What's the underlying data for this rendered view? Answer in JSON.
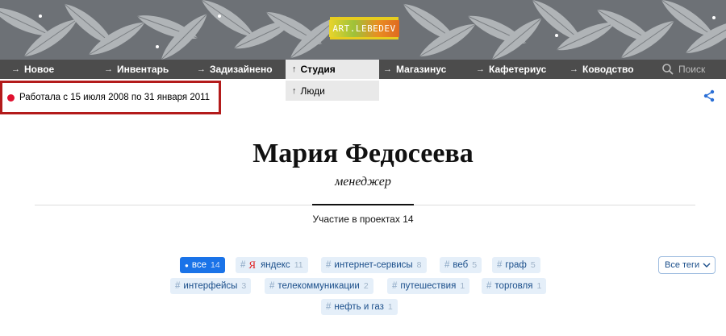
{
  "brand": {
    "logo_text": "ART.LEBEDEV"
  },
  "nav": {
    "items": [
      {
        "label": "Новое"
      },
      {
        "label": "Инвентарь"
      },
      {
        "label": "Задизайнено"
      },
      {
        "label": "Студия"
      },
      {
        "label": "Магазинус"
      },
      {
        "label": "Кафетериус"
      },
      {
        "label": "Ководство"
      }
    ],
    "sub_item": "Люди",
    "search_label": "Поиск",
    "arrow_glyph": "→",
    "up_arrow_glyph": "↑"
  },
  "status": {
    "text": "Работала с 15 июля 2008 по 31 января 2011",
    "color": "#e0102f"
  },
  "person": {
    "name": "Мария Федосеева",
    "role": "менеджер",
    "projects_text": "Участие в проектах 14"
  },
  "tags": [
    {
      "label": "все",
      "count": "14",
      "active": true
    },
    {
      "label": "яндекс",
      "count": "11",
      "icon": "Я"
    },
    {
      "label": "интернет-сервисы",
      "count": "8"
    },
    {
      "label": "веб",
      "count": "5"
    },
    {
      "label": "граф",
      "count": "5"
    },
    {
      "label": "интерфейсы",
      "count": "3"
    },
    {
      "label": "телекоммуникации",
      "count": "2"
    },
    {
      "label": "путешествия",
      "count": "1"
    },
    {
      "label": "торговля",
      "count": "1"
    },
    {
      "label": "нефть и газ",
      "count": "1"
    }
  ],
  "all_tags_label": "Все теги",
  "colors": {
    "nav_bg": "#4c4c4c",
    "accent": "#1a73e8",
    "tag_bg": "#e5eff9",
    "highlight": "#b31b1b"
  }
}
